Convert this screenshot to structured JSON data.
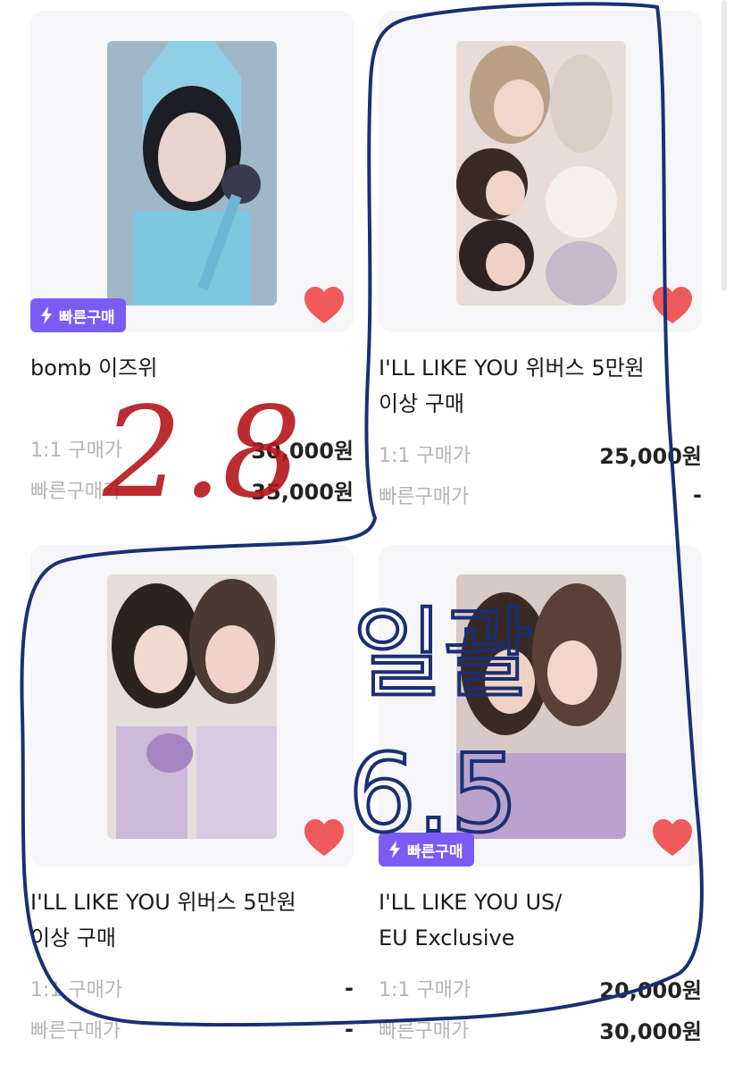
{
  "products": [
    {
      "title_lines": [
        "bomb 이즈위"
      ],
      "badge": "빠른구매",
      "price_rows": [
        {
          "label": "1:1 구매가",
          "value": "30,000원"
        },
        {
          "label": "빠른구매가",
          "value": "35,000원"
        }
      ],
      "liked": true
    },
    {
      "title_lines": [
        "I'LL LIKE YOU 위버스 5만원",
        "이상 구매"
      ],
      "price_rows": [
        {
          "label": "1:1 구매가",
          "value": "25,000원"
        },
        {
          "label": "빠른구매가",
          "value": "-"
        }
      ],
      "liked": true
    },
    {
      "title_lines": [
        "I'LL LIKE YOU 위버스 5만원",
        "이상 구매"
      ],
      "price_rows": [
        {
          "label": "1:1 구매가",
          "value": "-"
        },
        {
          "label": "빠른구매가",
          "value": "-"
        }
      ],
      "liked": true
    },
    {
      "title_lines": [
        "I'LL LIKE YOU US/",
        "EU Exclusive"
      ],
      "badge": "빠른구매",
      "price_rows": [
        {
          "label": "1:1 구매가",
          "value": "20,000원"
        },
        {
          "label": "빠른구매가",
          "value": "30,000원"
        }
      ],
      "liked": true
    }
  ],
  "annotations": {
    "red_note": "2.8",
    "blue_note_line1": "일괄",
    "blue_note_line2": "6.5"
  },
  "colors": {
    "badge": "#7a5cf5",
    "heart": "#ef5a5a",
    "red_ink": "#b4161b",
    "blue_ink": "#1b2f73"
  }
}
